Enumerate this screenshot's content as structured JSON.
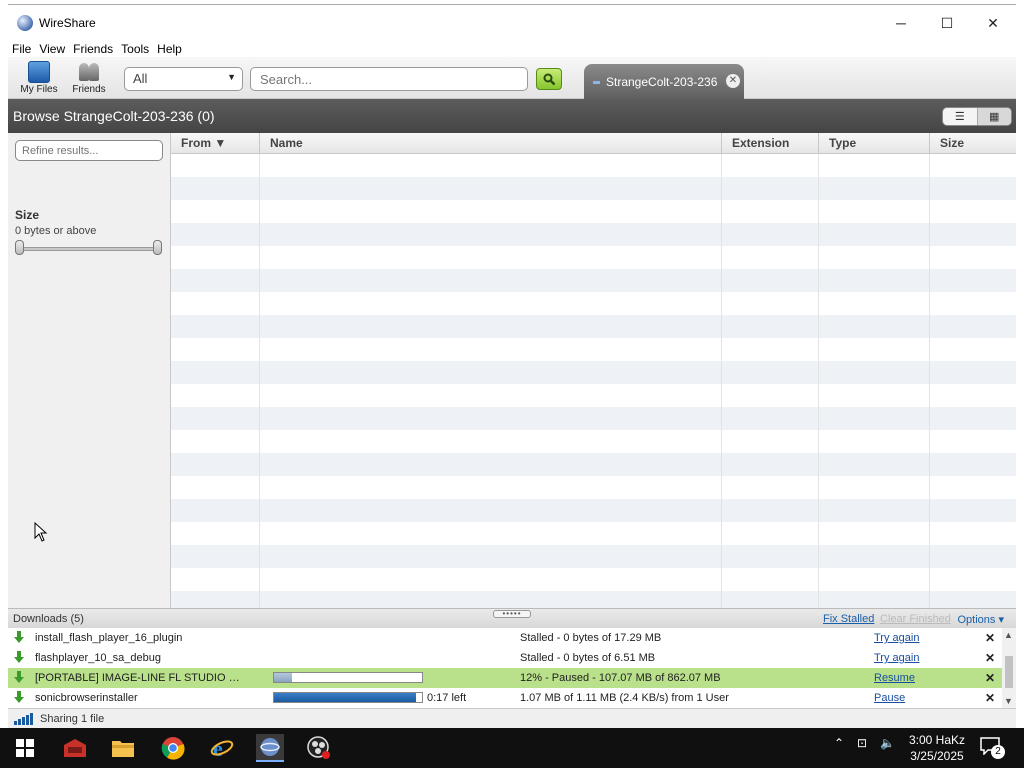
{
  "window": {
    "title": "WireShare",
    "controls": {
      "minimize": "─",
      "maximize": "☐",
      "close": "✕"
    }
  },
  "menu": [
    "File",
    "View",
    "Friends",
    "Tools",
    "Help"
  ],
  "toolbar": {
    "my_files": "My Files",
    "friends": "Friends",
    "category_value": "All",
    "search_placeholder": "Search...",
    "tab_label": "StrangeColt-203-236"
  },
  "browse": {
    "title": "Browse StrangeColt-203-236 (0)",
    "refine_placeholder": "Refine results...",
    "filter_title": "Size",
    "filter_value": "0 bytes or above",
    "columns": [
      "From ▼",
      "Name",
      "Extension",
      "Type",
      "Size"
    ],
    "rows": []
  },
  "downloads": {
    "header": "Downloads (5)",
    "fix_stalled": "Fix Stalled",
    "clear_finished": "Clear Finished",
    "options": "Options ▾",
    "items": [
      {
        "name": "install_flash_player_16_plugin",
        "status": "Stalled - 0 bytes of 17.29 MB",
        "action": "Try again",
        "progress": null,
        "time_left": ""
      },
      {
        "name": "flashplayer_10_sa_debug",
        "status": "Stalled - 0 bytes of 6.51 MB",
        "action": "Try again",
        "progress": null,
        "time_left": ""
      },
      {
        "name": "[PORTABLE] IMAGE-LINE FL STUDIO PR...",
        "status": "12% - Paused - 107.07 MB of 862.07 MB",
        "action": "Resume",
        "progress": 0.12,
        "time_left": ""
      },
      {
        "name": "sonicbrowserinstaller",
        "status": "1.07 MB of 1.11 MB (2.4 KB/s) from 1 User",
        "action": "Pause",
        "progress": 0.96,
        "time_left": "0:17 left"
      }
    ]
  },
  "status": {
    "sharing": "Sharing 1 file"
  },
  "taskbar": {
    "clock_time": "3:00 HaKz",
    "clock_date": "3/25/2025",
    "notification_count": "2"
  }
}
